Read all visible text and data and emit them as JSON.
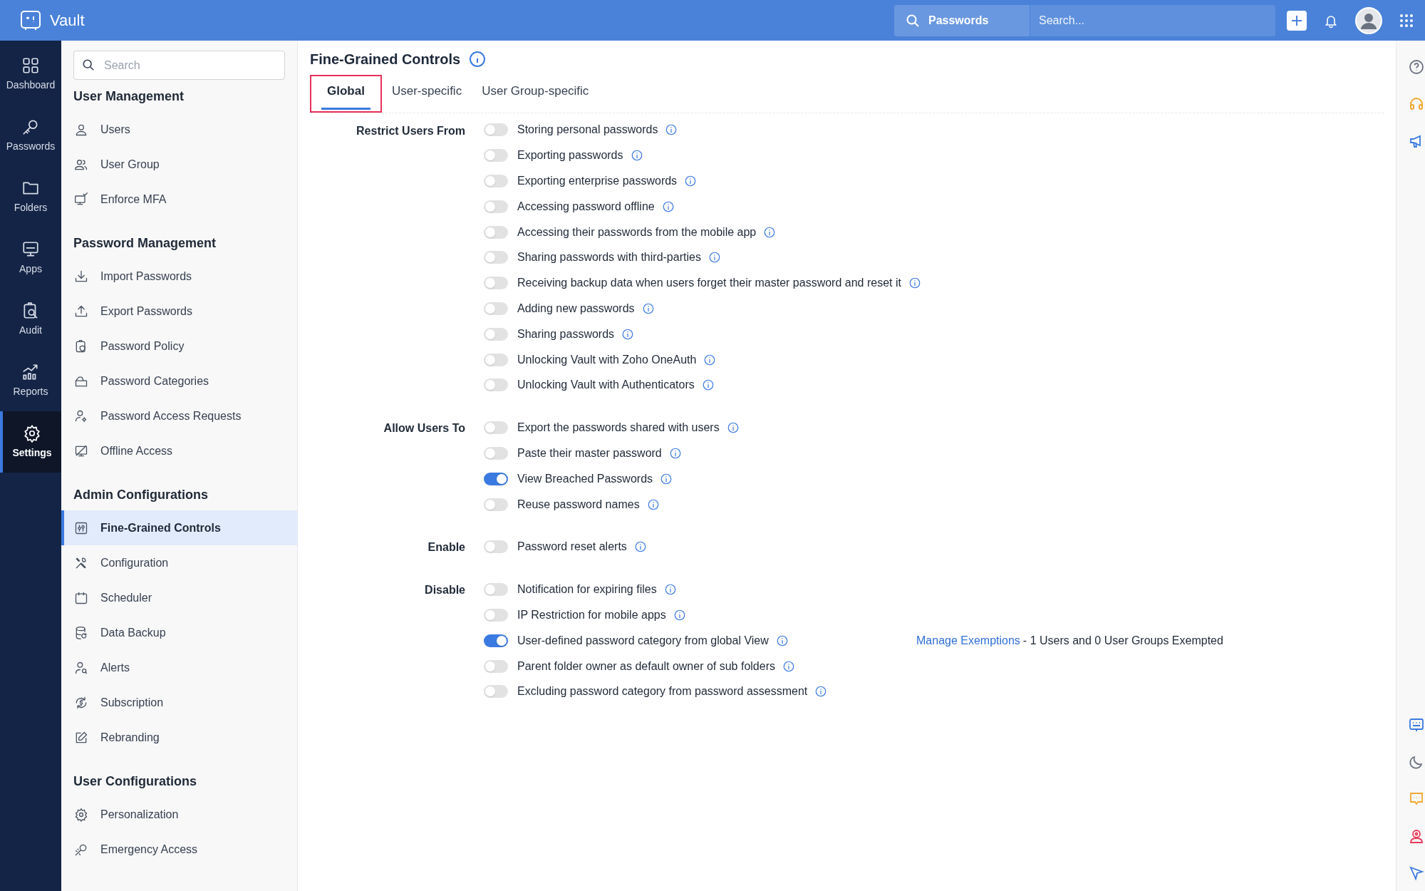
{
  "app": {
    "title": "Vault"
  },
  "top_search": {
    "scope": "Passwords",
    "placeholder": "Search..."
  },
  "rail": [
    {
      "label": "Dashboard",
      "selected": false
    },
    {
      "label": "Passwords",
      "selected": false
    },
    {
      "label": "Folders",
      "selected": false
    },
    {
      "label": "Apps",
      "selected": false
    },
    {
      "label": "Audit",
      "selected": false
    },
    {
      "label": "Reports",
      "selected": false
    },
    {
      "label": "Settings",
      "selected": true
    }
  ],
  "sidebar": {
    "search_placeholder": "Search",
    "sections": [
      {
        "title": "User Management",
        "items": [
          {
            "label": "Users",
            "selected": false
          },
          {
            "label": "User Group",
            "selected": false
          },
          {
            "label": "Enforce MFA",
            "selected": false
          }
        ]
      },
      {
        "title": "Password Management",
        "items": [
          {
            "label": "Import Passwords",
            "selected": false
          },
          {
            "label": "Export Passwords",
            "selected": false
          },
          {
            "label": "Password Policy",
            "selected": false
          },
          {
            "label": "Password Categories",
            "selected": false
          },
          {
            "label": "Password Access Requests",
            "selected": false
          },
          {
            "label": "Offline Access",
            "selected": false
          }
        ]
      },
      {
        "title": "Admin Configurations",
        "items": [
          {
            "label": "Fine-Grained Controls",
            "selected": true
          },
          {
            "label": "Configuration",
            "selected": false
          },
          {
            "label": "Scheduler",
            "selected": false
          },
          {
            "label": "Data Backup",
            "selected": false
          },
          {
            "label": "Alerts",
            "selected": false
          },
          {
            "label": "Subscription",
            "selected": false
          },
          {
            "label": "Rebranding",
            "selected": false
          }
        ]
      },
      {
        "title": "User Configurations",
        "items": [
          {
            "label": "Personalization",
            "selected": false
          },
          {
            "label": "Emergency Access",
            "selected": false
          }
        ]
      }
    ]
  },
  "page": {
    "title": "Fine-Grained Controls"
  },
  "tabs": [
    {
      "label": "Global",
      "selected": true,
      "highlighted": true
    },
    {
      "label": "User-specific",
      "selected": false,
      "highlighted": false
    },
    {
      "label": "User Group-specific",
      "selected": false,
      "highlighted": false
    }
  ],
  "groups": [
    {
      "label": "Restrict Users From",
      "settings": [
        {
          "label": "Storing personal passwords",
          "on": false
        },
        {
          "label": "Exporting passwords",
          "on": false
        },
        {
          "label": "Exporting enterprise passwords",
          "on": false
        },
        {
          "label": "Accessing password offline",
          "on": false
        },
        {
          "label": "Accessing their passwords from the mobile app",
          "on": false
        },
        {
          "label": "Sharing passwords with third-parties",
          "on": false
        },
        {
          "label": "Receiving backup data when users forget their master password and reset it",
          "on": false
        },
        {
          "label": "Adding new passwords",
          "on": false
        },
        {
          "label": "Sharing passwords",
          "on": false
        },
        {
          "label": "Unlocking Vault with Zoho OneAuth",
          "on": false
        },
        {
          "label": "Unlocking Vault with Authenticators",
          "on": false
        }
      ]
    },
    {
      "label": "Allow Users To",
      "settings": [
        {
          "label": "Export the passwords shared with users",
          "on": false
        },
        {
          "label": "Paste their master password",
          "on": false
        },
        {
          "label": "View Breached Passwords",
          "on": true
        },
        {
          "label": "Reuse password names",
          "on": false
        }
      ]
    },
    {
      "label": "Enable",
      "settings": [
        {
          "label": "Password reset alerts",
          "on": false
        }
      ]
    },
    {
      "label": "Disable",
      "settings": [
        {
          "label": "Notification for expiring files",
          "on": false
        },
        {
          "label": "IP Restriction for mobile apps",
          "on": false
        },
        {
          "label": "User-defined password category from global View",
          "on": true,
          "link": "Manage Exemptions",
          "note": "- 1 Users and 0 User Groups Exempted"
        },
        {
          "label": "Parent folder owner as default owner of sub folders",
          "on": false
        },
        {
          "label": "Excluding password category from password assessment",
          "on": false
        }
      ]
    }
  ]
}
